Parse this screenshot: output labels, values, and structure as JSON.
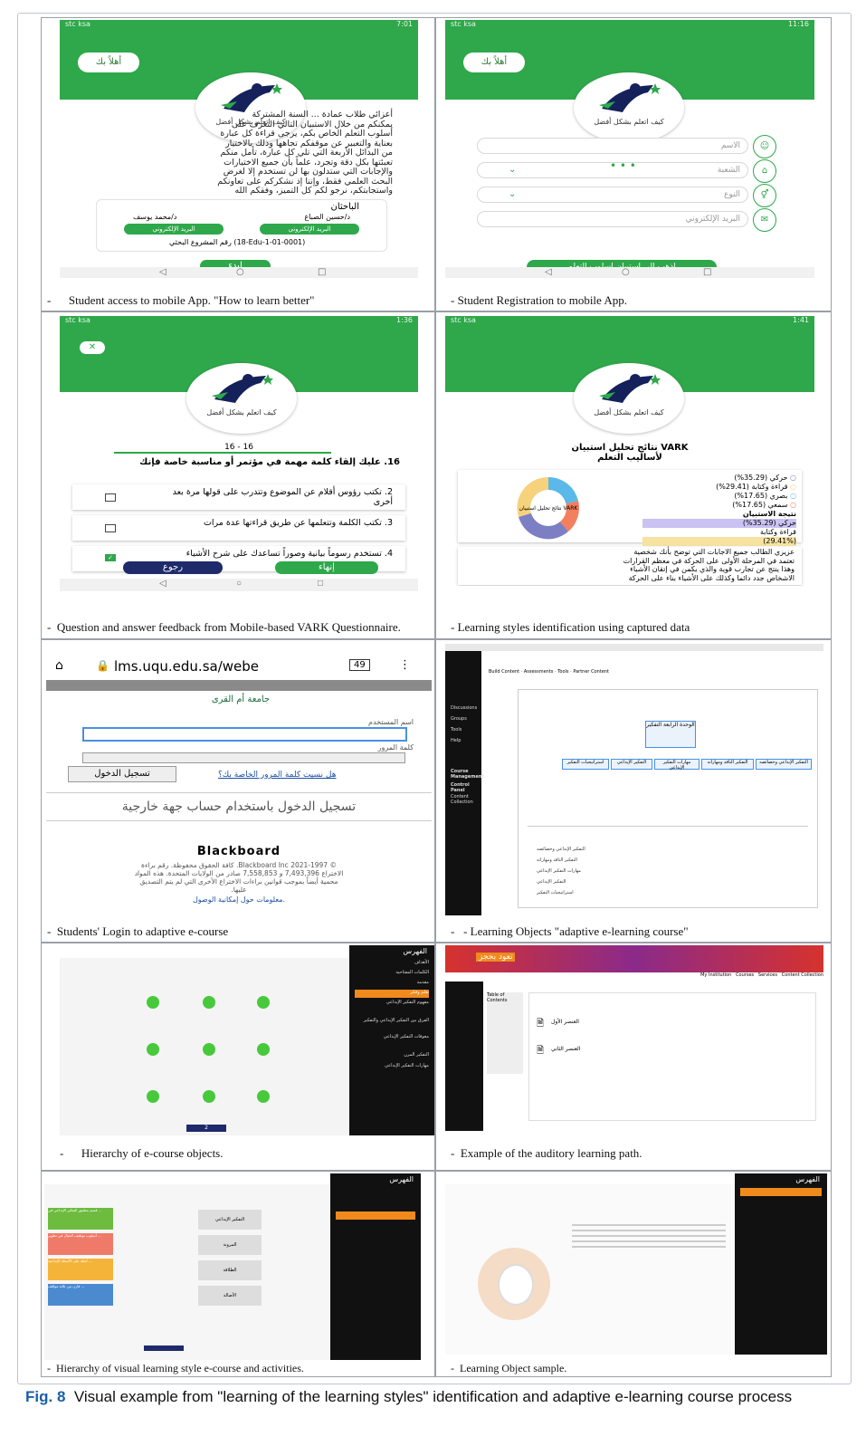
{
  "figure": {
    "caption_label": "Fig. 8",
    "caption_text": "Visual example from \"learning of the learning styles\" identification and adaptive e-learning course process"
  },
  "panels": {
    "p1": {
      "caption": "Student access to mobile App. \"How to learn better\"",
      "status_left": "stc ksa",
      "status_right": "7:01",
      "welcome": "أهلاً بك",
      "logo_text": "كيف اتعلم بشكل أفضل",
      "body_lines": [
        "أعزائي طلاب عمادة ... السنة المشتركة",
        "يمكنكم من خلال الاستبيان التالي التعرف على",
        "أسلوب التعلم الخاص بكم، يرجى قراءة كل عبارة",
        "بعناية والتعبير عن موقفكم تجاهها وذلك بالاختيار",
        "من البدائل الأربعة التي تلي كل عبارة، تأمل منكم",
        "تعبئتها بكل دقة وتجرد، علماً بأن جميع الاختيارات",
        "والإجابات التي ستدلون بها لن تستخدم إلا لغرض",
        "البحث العلمي فقط، وإننا إذ نشكركم على تعاونكم",
        "واستجابتكم، نرجو لكم كل التميز، وفقكم الله"
      ],
      "researchers_title": "الباحثان",
      "researcher1": "د/حسين الصباغ",
      "researcher2": "د/محمد يوسف",
      "email_label": "البريد الإلكتروني",
      "project_no": "رقم المشروع البحثي (18-Edu-1-01-0001)",
      "start": "إبدء"
    },
    "p2": {
      "caption": "- Student Registration to mobile App.",
      "status_left": "stc ksa",
      "status_right": "11:16",
      "welcome": "أهلاً بك",
      "logo_text": "كيف اتعلم بشكل أفضل",
      "fields": [
        "الاسم",
        "الشعبة",
        "النوع",
        "البريد الإلكتروني"
      ],
      "go_button": "اذهب الى استبيان اسلوب التعلم"
    },
    "p3": {
      "caption": "Question and answer feedback from Mobile-based VARK Questionnaire.",
      "status_left": "stc ksa",
      "status_right": "1:36",
      "logo_text": "كيف اتعلم بشكل أفضل",
      "counter": "16 - 16",
      "question": "16. عليك إلقاء كلمة مهمة في مؤتمر أو مناسبة خاصة فإنك",
      "options": [
        "2. تكتب رؤوس أقلام عن الموضوع وتتدرب على قولها مرة بعد أخرى",
        "3. تكتب الكلمة وتتعلمها عن طريق قراءتها عدة مرات",
        "4. تستخدم رسوماً بيانية وصوراً تساعدك على شرح الأشياء"
      ],
      "finish": "إنهاء",
      "back": "رجوع"
    },
    "p4": {
      "caption": "- Learning styles identification using captured data",
      "status_left": "stc ksa",
      "status_right": "1:41",
      "logo_text": "كيف اتعلم بشكل أفضل",
      "title1": "نتائج تحليل استبيان VARK",
      "title2": "لأساليب التعلم",
      "chart_center": "نتائج تحليل استبيان VARK",
      "legend": [
        "حركي (35.29%)",
        "قراءة وكتابة (29.41%)",
        "بصري (17.65%)",
        "سمعي (17.65%)"
      ],
      "result_title": "نتيجة الاستبيان",
      "result_lines": [
        "حركي (35.29%)",
        "قراءة وكتابة",
        "(29.41%)"
      ],
      "advice_lines": [
        "عزيزي الطالب جميع الاجابات التي توضح بأنك شخصية",
        "تعتمد في المرحلة الأولى على الحركة في معظم القرارات",
        "وهذا ينتج عن تجارب قوية والذي يكمن في إتقان الأشياء",
        "الاشخاص جدد دائما وكذلك على الأشياء بناء على الحركة"
      ]
    },
    "p5": {
      "caption": "Students' Login to adaptive e-course",
      "url": "lms.uqu.edu.sa/webe",
      "tabs": "49",
      "university": "جامعة أم القرى",
      "username_label": "اسم المستخدم",
      "password_label": "كلمة المرور",
      "login_button": "تسجيل الدخول",
      "forgot": "هل نسيت كلمة المرور الخاصة بك؟",
      "external": "تسجيل الدخول باستخدام حساب جهة خارجية",
      "brand": "Blackboard",
      "copyright_lines": [
        "© 2021-1997 Blackboard Inc. كافة الحقوق محفوظة. رقم براءة",
        "الاختراع 7,493,396 و 7,558,853 صادر من الولايات المتحدة. هذه المواد",
        "محمية أيضاً بموجب قوانين براءات الاختراع الأخرى التي لم يتم التصديق",
        "عليها."
      ],
      "accessibility": "معلومات حول إمكانية الوصول."
    },
    "p6": {
      "caption": "- Learning Objects \"adaptive e-learning course\"",
      "toolbar": [
        "Build Content",
        "Assessments",
        "Tools",
        "Partner Content"
      ],
      "node_root": "الوحدة الرابعة التفكير",
      "nodes": [
        "التفكير الإبداعي وخصائصه",
        "التفكير الناقد ومهاراته",
        "مهارات التفكير الإبداعي",
        "التفكير الإبداعي",
        "استراتيجيات التفكير"
      ],
      "sidebar": [
        "Discussions",
        "Groups",
        "Tools",
        "Help",
        "Course Management",
        "Control Panel",
        "Content Collection"
      ]
    },
    "p7": {
      "caption": "Hierarchy of e-course objects.",
      "menu_title": "الفهرس",
      "menu_items": [
        "الأهداف",
        "الكلمات المفتاحية",
        "مقدمة",
        "تعلم وفكر",
        "مفهوم التفكير الإبداعي",
        "الفرق بين التفكير الإبداعي والتفكير",
        "معوقات التفكير الإبداعي",
        "التفكير المرن",
        "مهارات التفكير الإبداعي"
      ],
      "pager": "2"
    },
    "p8": {
      "caption": "Example of the auditory learning path.",
      "brand": "تعود بحجز",
      "nav": [
        "My Institution",
        "Courses",
        "Services",
        "Content Collection"
      ],
      "toc": "Table of Contents",
      "items": [
        "العنصر الأول",
        "العنصر الثاني"
      ]
    },
    "p9": {
      "caption": "Hierarchy of visual learning style e-course and activities.",
      "menu_title": "الفهرس",
      "cards": [
        "قسم بتطبيق التفكير الإبداعي في ...",
        "أسلوب توظيف الخيال في تطوير ...",
        "أمثلة على الأسئلة الإبداعية ...",
        "قارن بين ثلاثة مواقف ..."
      ],
      "center_labels": [
        "التفكير الإبداعي",
        "المرونة",
        "الطلاقة",
        "الأصالة"
      ]
    },
    "p10": {
      "caption": "Learning Object sample.",
      "menu_title": "الفهرس"
    }
  },
  "colors": {
    "app_green": "#2ea84a",
    "navy": "#1f2a6b",
    "bb_red": "#d6322e",
    "pie": [
      "#f27f5e",
      "#5ab9e9",
      "#7c7fc4",
      "#f7d27c"
    ]
  }
}
